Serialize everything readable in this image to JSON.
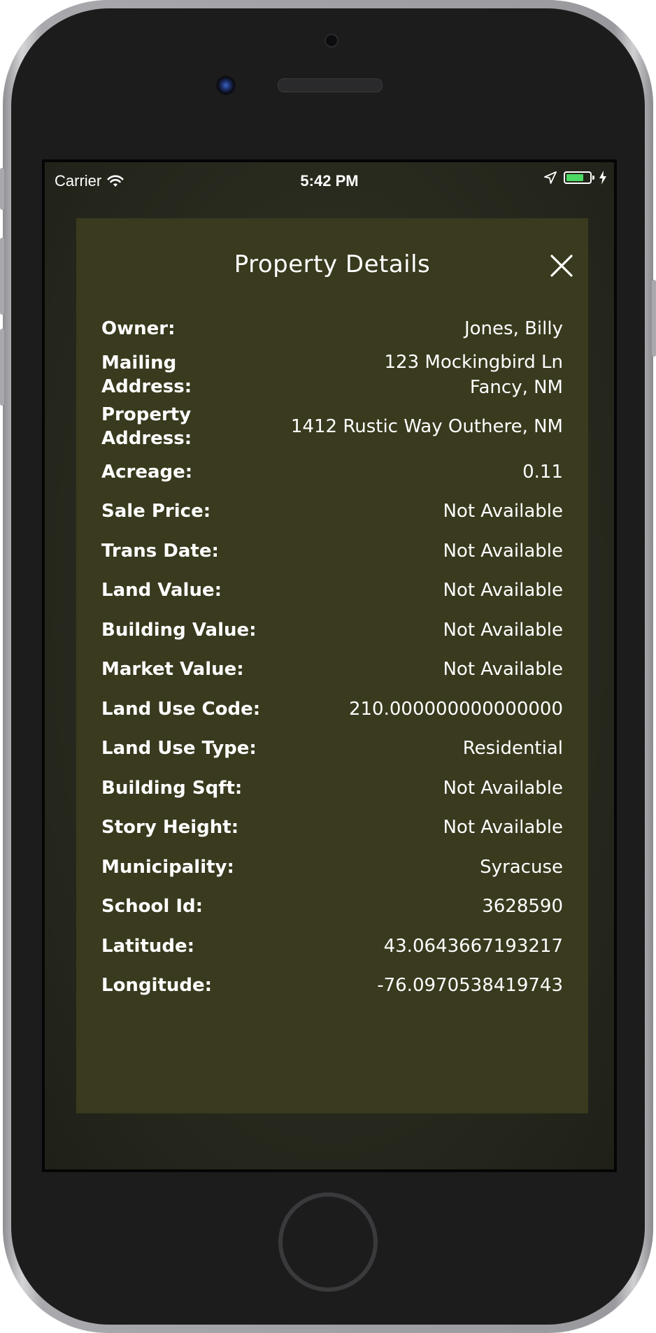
{
  "status_bar": {
    "carrier": "Carrier",
    "time": "5:42 PM"
  },
  "panel": {
    "title": "Property Details",
    "close_icon": "close-icon"
  },
  "details": [
    {
      "label": "Owner:",
      "value": "Jones, Billy"
    },
    {
      "label": "Mailing Address:",
      "value": "123 Mockingbird Ln\nFancy, NM"
    },
    {
      "label": "Property Address:",
      "value": "1412 Rustic Way Outhere, NM"
    },
    {
      "label": "Acreage:",
      "value": "0.11"
    },
    {
      "label": "Sale Price:",
      "value": "Not Available"
    },
    {
      "label": "Trans Date:",
      "value": "Not Available"
    },
    {
      "label": "Land Value:",
      "value": "Not Available"
    },
    {
      "label": "Building Value:",
      "value": "Not Available"
    },
    {
      "label": "Market Value:",
      "value": "Not Available"
    },
    {
      "label": "Land Use Code:",
      "value": "210.000000000000000"
    },
    {
      "label": "Land Use Type:",
      "value": "Residential"
    },
    {
      "label": "Building Sqft:",
      "value": "Not Available"
    },
    {
      "label": "Story Height:",
      "value": "Not Available"
    },
    {
      "label": "Municipality:",
      "value": "Syracuse"
    },
    {
      "label": "School Id:",
      "value": "3628590"
    },
    {
      "label": "Latitude:",
      "value": "43.0643667193217"
    },
    {
      "label": "Longitude:",
      "value": "-76.0970538419743"
    }
  ],
  "colors": {
    "panel_bg": "#393a1e",
    "battery_green": "#4cd964"
  }
}
